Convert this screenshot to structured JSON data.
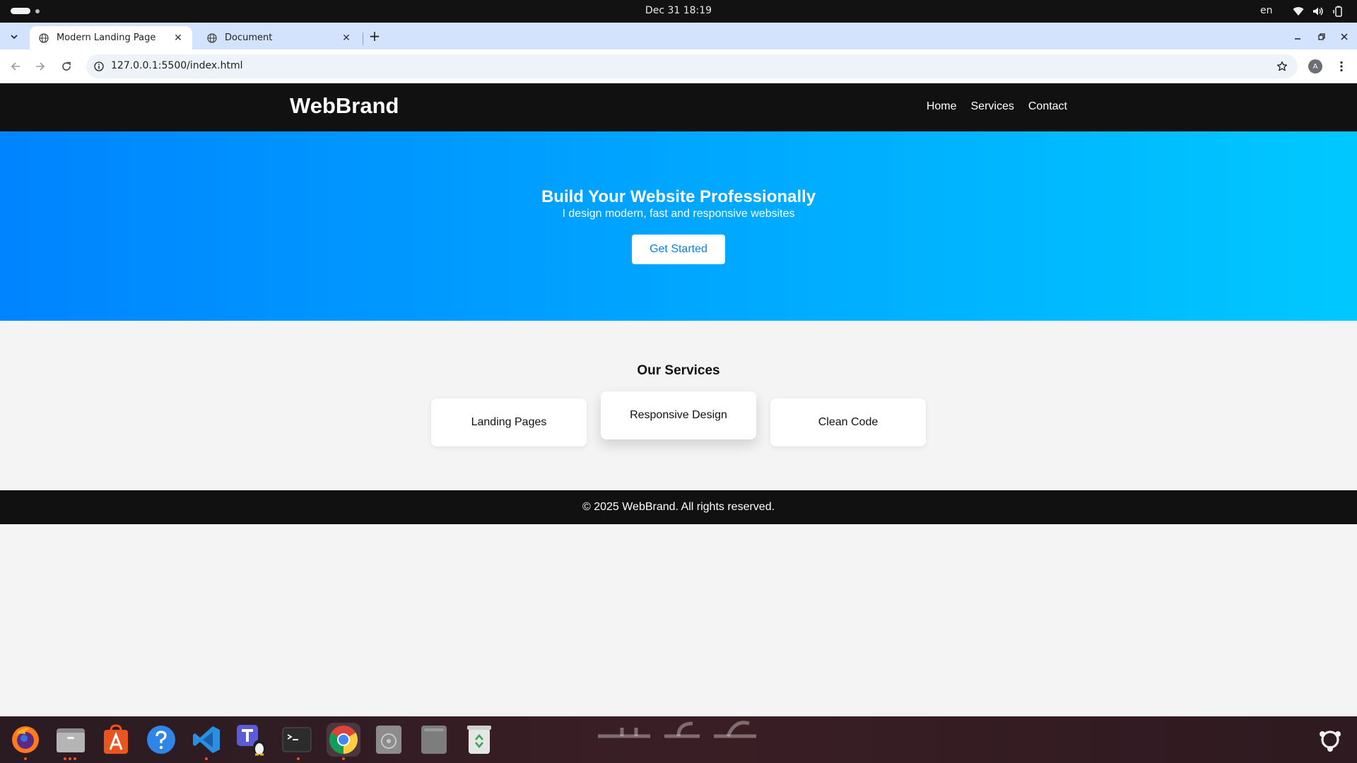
{
  "system": {
    "clock": "Dec 31  18:19",
    "lang": "en",
    "icons": [
      "wifi-icon",
      "volume-icon",
      "battery-icon"
    ]
  },
  "browser": {
    "tabs": [
      {
        "title": "Modern Landing Page",
        "active": true
      },
      {
        "title": "Document",
        "active": false
      }
    ],
    "url": "127.0.0.1:5500/index.html",
    "profile_initial": "A"
  },
  "site": {
    "brand": "WebBrand",
    "nav": [
      "Home",
      "Services",
      "Contact"
    ],
    "hero": {
      "title": "Build Your Website Professionally",
      "subtitle": "I design modern, fast and responsive websites",
      "cta": "Get Started"
    },
    "services": {
      "heading": "Our Services",
      "items": [
        "Landing Pages",
        "Responsive Design",
        "Clean Code"
      ]
    },
    "footer": "© 2025 WebBrand. All rights reserved."
  },
  "dock": {
    "apps": [
      "firefox-icon",
      "files-icon",
      "app-center-icon",
      "help-icon",
      "vscode-icon",
      "terminal-tux-icon",
      "terminal-icon",
      "chrome-icon",
      "disk-icon",
      "ssd-icon",
      "trash-icon"
    ]
  },
  "colors": {
    "hero_start": "#0084ff",
    "hero_end": "#00c8ff",
    "header_bg": "#111111",
    "tabstrip_bg": "#d3e3fd"
  }
}
